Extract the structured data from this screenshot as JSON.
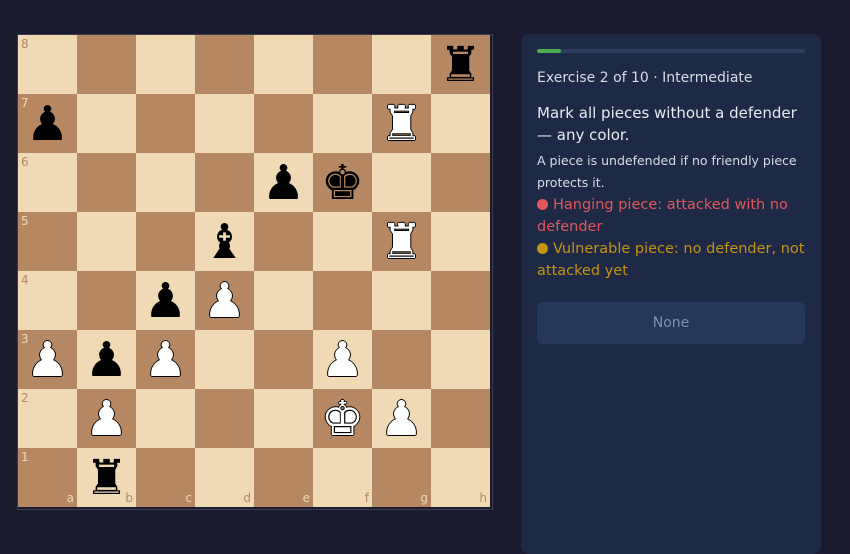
{
  "board": {
    "files": [
      "a",
      "b",
      "c",
      "d",
      "e",
      "f",
      "g",
      "h"
    ],
    "ranks": [
      "8",
      "7",
      "6",
      "5",
      "4",
      "3",
      "2",
      "1"
    ],
    "light_color": "#f0d9b5",
    "dark_color": "#b58863",
    "pieces": [
      {
        "square": "h8",
        "type": "rook",
        "color": "black",
        "glyph": "♜"
      },
      {
        "square": "a7",
        "type": "pawn",
        "color": "black",
        "glyph": "♟"
      },
      {
        "square": "g7",
        "type": "rook",
        "color": "white",
        "glyph": "♜"
      },
      {
        "square": "e6",
        "type": "pawn",
        "color": "black",
        "glyph": "♟"
      },
      {
        "square": "f6",
        "type": "king",
        "color": "black",
        "glyph": "♚"
      },
      {
        "square": "d5",
        "type": "bishop",
        "color": "black",
        "glyph": "♝"
      },
      {
        "square": "g5",
        "type": "rook",
        "color": "white",
        "glyph": "♜"
      },
      {
        "square": "c4",
        "type": "pawn",
        "color": "black",
        "glyph": "♟"
      },
      {
        "square": "d4",
        "type": "pawn",
        "color": "white",
        "glyph": "♟"
      },
      {
        "square": "a3",
        "type": "pawn",
        "color": "white",
        "glyph": "♟"
      },
      {
        "square": "b3",
        "type": "pawn",
        "color": "black",
        "glyph": "♟"
      },
      {
        "square": "c3",
        "type": "pawn",
        "color": "white",
        "glyph": "♟"
      },
      {
        "square": "f3",
        "type": "pawn",
        "color": "white",
        "glyph": "♟"
      },
      {
        "square": "b2",
        "type": "pawn",
        "color": "white",
        "glyph": "♟"
      },
      {
        "square": "f2",
        "type": "king",
        "color": "white",
        "glyph": "♚"
      },
      {
        "square": "g2",
        "type": "pawn",
        "color": "white",
        "glyph": "♟"
      },
      {
        "square": "b1",
        "type": "rook",
        "color": "black",
        "glyph": "♜"
      }
    ]
  },
  "panel": {
    "progress_fraction": 0.09,
    "progress_color": "#4caf50",
    "exercise_title": "Exercise 2 of 10 · Intermediate",
    "instruction": "Mark all pieces without a defender — any color.",
    "explanation": "A piece is undefended if no friendly piece protects it.",
    "legend_hanging": "Hanging piece: attacked with no defender",
    "legend_hanging_color": "#e0575b",
    "legend_vulnerable": "Vulnerable piece: no defender, not attacked yet",
    "legend_vulnerable_color": "#c69212",
    "none_button_label": "None"
  }
}
